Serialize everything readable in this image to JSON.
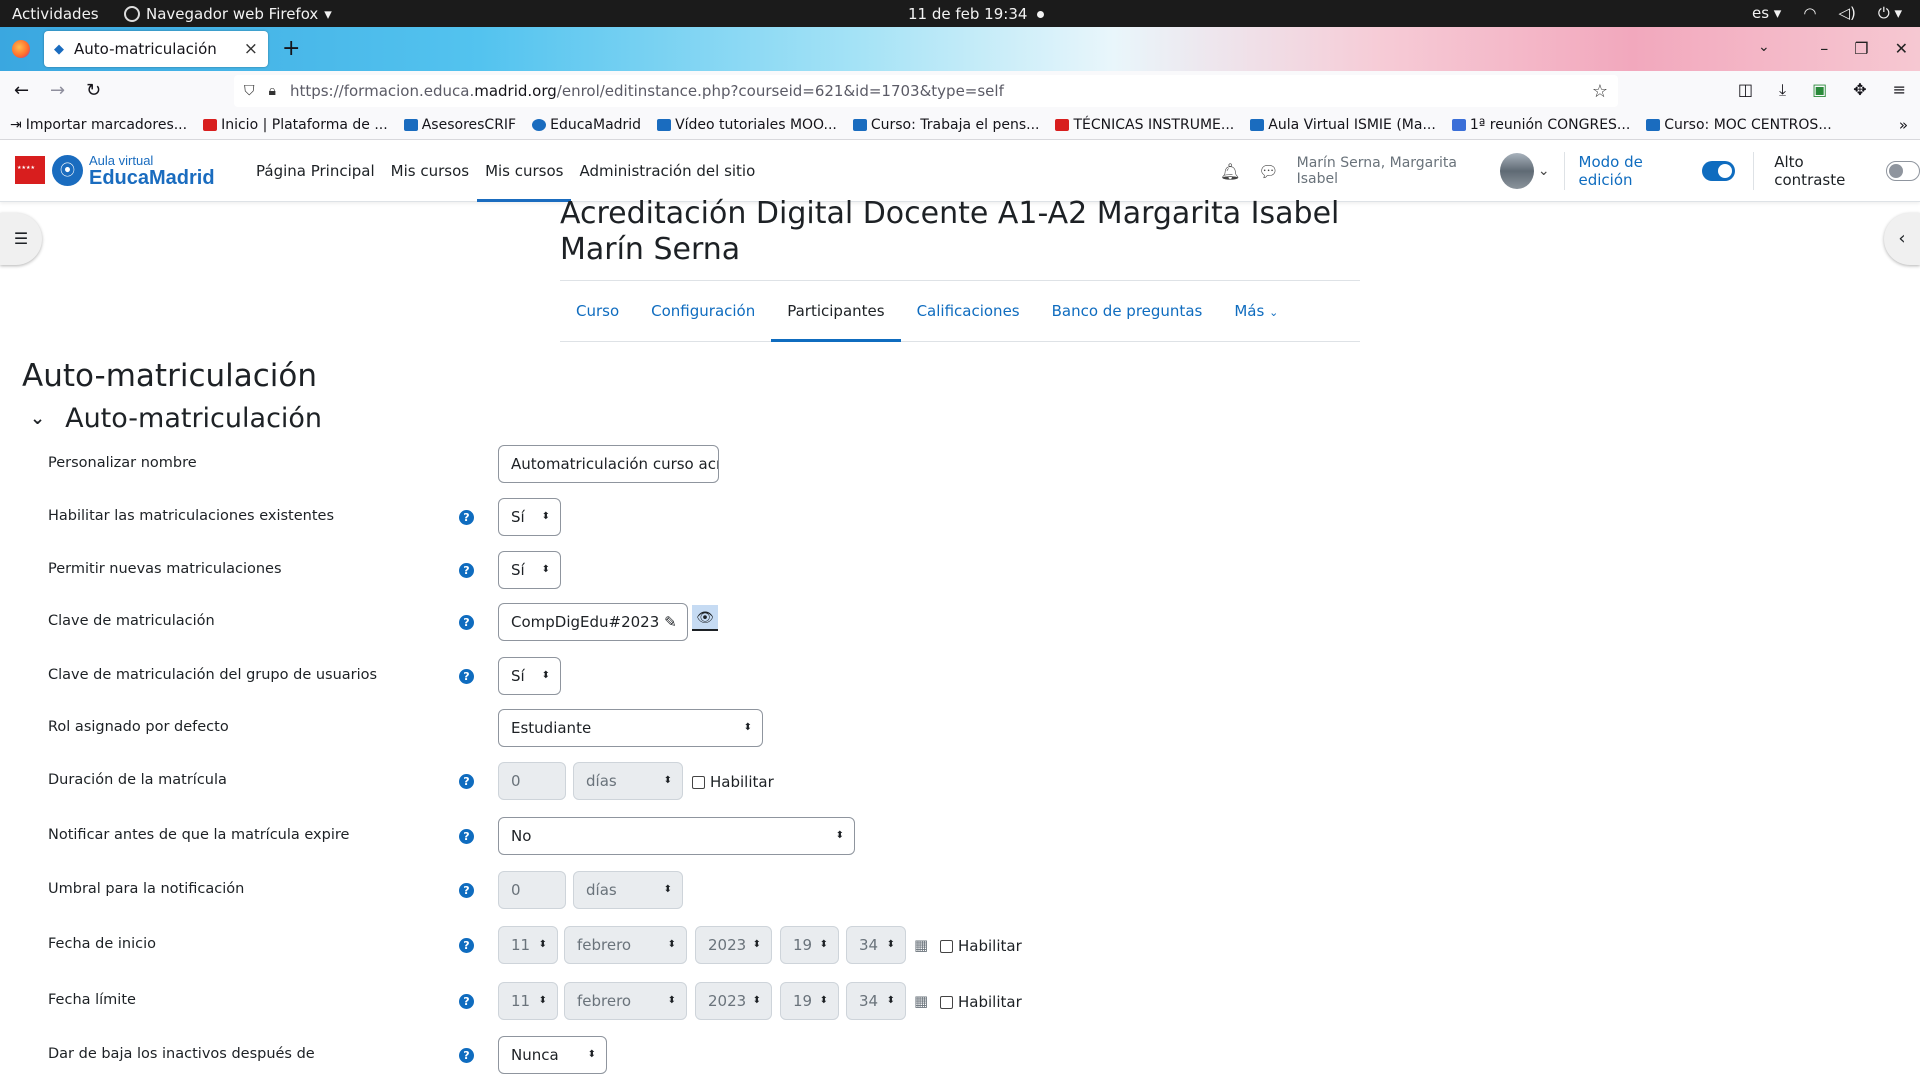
{
  "os_bar": {
    "activities": "Actividades",
    "app_name": "Navegador web Firefox",
    "clock": "11 de feb  19:34",
    "lang": "es"
  },
  "browser": {
    "tab_title": "Auto-matriculación",
    "url_prefix": "https://formacion.educa.",
    "url_host": "madrid.org",
    "url_path": "/enrol/editinstance.php?courseid=621&id=1703&type=self",
    "bookmarks": [
      {
        "label": "Importar marcadores...",
        "color": "#444444"
      },
      {
        "label": "Inicio | Plataforma de ...",
        "color": "#d81e1e"
      },
      {
        "label": "AsesoresCRIF",
        "color": "#1a6cbf"
      },
      {
        "label": "EducaMadrid",
        "color": "#1a6cbf"
      },
      {
        "label": "Vídeo tutoriales MOO...",
        "color": "#1a6cbf"
      },
      {
        "label": "Curso: Trabaja el pens...",
        "color": "#1a6cbf"
      },
      {
        "label": "TÉCNICAS INSTRUME...",
        "color": "#d81e1e"
      },
      {
        "label": "Aula Virtual ISMIE (Ma...",
        "color": "#1a6cbf"
      },
      {
        "label": "1ª reunión CONGRES...",
        "color": "#3b6fd8"
      },
      {
        "label": "Curso: MOC CENTROS...",
        "color": "#1a6cbf"
      }
    ]
  },
  "header": {
    "logo_sub": "Aula virtual",
    "logo_main": "EducaMadrid",
    "nav": [
      "Página Principal",
      "Mis cursos",
      "Mis cursos",
      "Administración del sitio"
    ],
    "user_name": "Marín Serna, Margarita Isabel",
    "edit_mode_label": "Modo de edición",
    "edit_mode_on": true,
    "high_contrast_label": "Alto contraste",
    "high_contrast_on": false
  },
  "course": {
    "title": "Acreditación Digital Docente A1-A2 Margarita Isabel Marín Serna",
    "tabs": [
      "Curso",
      "Configuración",
      "Participantes",
      "Calificaciones",
      "Banco de preguntas",
      "Más"
    ],
    "active_tab": "Participantes"
  },
  "page": {
    "heading": "Auto-matriculación",
    "section": "Auto-matriculación"
  },
  "form": {
    "custom_name": {
      "label": "Personalizar nombre",
      "value": "Automatriculación curso acr"
    },
    "existing": {
      "label": "Habilitar las matriculaciones existentes",
      "value": "Sí"
    },
    "new_enrols": {
      "label": "Permitir nuevas matriculaciones",
      "value": "Sí"
    },
    "enrol_key": {
      "label": "Clave de matriculación",
      "value": "CompDigEdu#2023"
    },
    "group_key": {
      "label": "Clave de matriculación del grupo de usuarios",
      "value": "Sí"
    },
    "role": {
      "label": "Rol asignado por defecto",
      "value": "Estudiante"
    },
    "duration": {
      "label": "Duración de la matrícula",
      "number": "0",
      "unit": "días",
      "enable": "Habilitar"
    },
    "notify": {
      "label": "Notificar antes de que la matrícula expire",
      "value": "No"
    },
    "threshold": {
      "label": "Umbral para la notificación",
      "number": "0",
      "unit": "días"
    },
    "start": {
      "label": "Fecha de inicio",
      "day": "11",
      "month": "febrero",
      "year": "2023",
      "hour": "19",
      "minute": "34",
      "enable": "Habilitar"
    },
    "end": {
      "label": "Fecha límite",
      "day": "11",
      "month": "febrero",
      "year": "2023",
      "hour": "19",
      "minute": "34",
      "enable": "Habilitar"
    },
    "inactive": {
      "label": "Dar de baja los inactivos después de",
      "value": "Nunca"
    }
  }
}
